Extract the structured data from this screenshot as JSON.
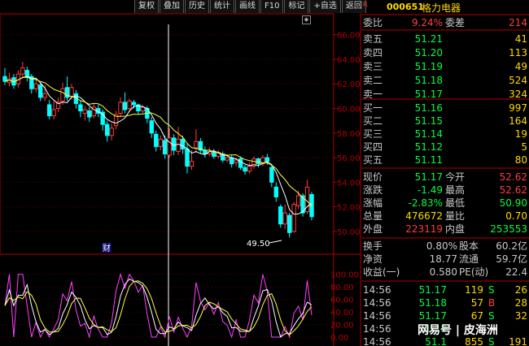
{
  "toolbar": [
    {
      "label": "复权"
    },
    {
      "label": "叠加"
    },
    {
      "label": "历史"
    },
    {
      "label": "统计"
    },
    {
      "label": "画线"
    },
    {
      "label": "F10"
    },
    {
      "label": "标记"
    },
    {
      "label": "+自选"
    },
    {
      "label": "返回"
    }
  ],
  "stock": {
    "code": "000651",
    "name": "格力电器",
    "badge": "R"
  },
  "weibi": {
    "label1": "委比",
    "value1": "9.24%",
    "label2": "委差",
    "value2": "214"
  },
  "sell": [
    {
      "label": "卖五",
      "price": "51.21",
      "vol": "41"
    },
    {
      "label": "卖四",
      "price": "51.20",
      "vol": "113"
    },
    {
      "label": "卖三",
      "price": "51.19",
      "vol": "49"
    },
    {
      "label": "卖二",
      "price": "51.18",
      "vol": "524"
    },
    {
      "label": "卖一",
      "price": "51.17",
      "vol": "324"
    }
  ],
  "buy": [
    {
      "label": "买一",
      "price": "51.16",
      "vol": "997"
    },
    {
      "label": "买二",
      "price": "51.15",
      "vol": "164"
    },
    {
      "label": "买三",
      "price": "51.14",
      "vol": "19"
    },
    {
      "label": "买四",
      "price": "51.12",
      "vol": "5"
    },
    {
      "label": "买五",
      "price": "51.11",
      "vol": "80"
    }
  ],
  "quote": [
    {
      "l1": "现价",
      "v1": "51.17",
      "l2": "今开",
      "v2": "52.62"
    },
    {
      "l1": "涨跌",
      "v1": "-1.49",
      "l2": "最高",
      "v2": "52.62"
    },
    {
      "l1": "涨幅",
      "v1": "-2.83%",
      "l2": "最低",
      "v2": "50.90"
    },
    {
      "l1": "总量",
      "v1": "476672",
      "l2": "量比",
      "v2": "0.70"
    },
    {
      "l1": "外盘",
      "v1": "223119",
      "l2": "内盘",
      "v2": "253553"
    }
  ],
  "fund": [
    {
      "l1": "换手",
      "v1": "0.80%",
      "l2": "股本",
      "v2": "60.2亿"
    },
    {
      "l1": "净资",
      "v1": "18.77",
      "l2": "流通",
      "v2": "59.7亿"
    },
    {
      "l1": "收益(一)",
      "v1": "0.580",
      "l2": "PE(动)",
      "v2": "22.4"
    }
  ],
  "ticks": [
    {
      "time": "14:56",
      "price": "51.17",
      "vol": "119",
      "bs": "S",
      "n": "26"
    },
    {
      "time": "14:56",
      "price": "51.18",
      "vol": "57",
      "bs": "B",
      "n": "28"
    },
    {
      "time": "14:56",
      "price": "51.17",
      "vol": "67",
      "bs": "S",
      "n": "32"
    },
    {
      "time": "14:56",
      "price": "51.18",
      "vol": "",
      "bs": "",
      "n": ""
    },
    {
      "time": "14:56",
      "price": "51.1",
      "vol": "855",
      "bs": "S",
      "n": "191"
    }
  ],
  "watermark": "网易号 | 皮海洲",
  "colors": {
    "up": "#ff3c3c",
    "down": "#00ffff",
    "price_green": "#00ff40",
    "yellow": "#ffd800",
    "ma": "#ffff40",
    "axis": "#b00000"
  },
  "chart_data": {
    "type": "candlestick",
    "y_ticks": [
      "66.00",
      "64.00",
      "62.00",
      "60.00",
      "58.00",
      "56.00",
      "54.00",
      "52.00",
      "50.00"
    ],
    "ylim": [
      49.0,
      67.5
    ],
    "low_annotation": "49.50",
    "marker_label": "财",
    "candles": [
      {
        "o": 62.6,
        "c": 62.2,
        "h": 63.3,
        "l": 61.9
      },
      {
        "o": 62.1,
        "c": 62.4,
        "h": 62.9,
        "l": 61.8
      },
      {
        "o": 62.5,
        "c": 61.9,
        "h": 62.8,
        "l": 61.6
      },
      {
        "o": 62.0,
        "c": 62.8,
        "h": 63.1,
        "l": 61.7
      },
      {
        "o": 62.8,
        "c": 63.3,
        "h": 63.8,
        "l": 62.5
      },
      {
        "o": 63.1,
        "c": 62.6,
        "h": 63.4,
        "l": 62.2
      },
      {
        "o": 62.6,
        "c": 61.6,
        "h": 62.8,
        "l": 61.2
      },
      {
        "o": 61.6,
        "c": 62.0,
        "h": 62.5,
        "l": 61.3
      },
      {
        "o": 61.9,
        "c": 60.9,
        "h": 62.1,
        "l": 60.6
      },
      {
        "o": 60.9,
        "c": 61.2,
        "h": 61.9,
        "l": 60.6
      },
      {
        "o": 60.3,
        "c": 59.4,
        "h": 60.7,
        "l": 59.1
      },
      {
        "o": 59.4,
        "c": 59.9,
        "h": 60.6,
        "l": 59.1
      },
      {
        "o": 60.0,
        "c": 60.5,
        "h": 60.9,
        "l": 59.7
      },
      {
        "o": 60.6,
        "c": 61.6,
        "h": 62.1,
        "l": 60.3
      },
      {
        "o": 61.7,
        "c": 60.9,
        "h": 62.6,
        "l": 60.6
      },
      {
        "o": 61.0,
        "c": 61.7,
        "h": 62.0,
        "l": 60.7
      },
      {
        "o": 61.2,
        "c": 60.4,
        "h": 61.5,
        "l": 60.0
      },
      {
        "o": 60.3,
        "c": 59.8,
        "h": 60.6,
        "l": 59.3
      },
      {
        "o": 59.6,
        "c": 59.9,
        "h": 60.2,
        "l": 59.0
      },
      {
        "o": 59.8,
        "c": 59.3,
        "h": 60.1,
        "l": 58.9
      },
      {
        "o": 59.4,
        "c": 60.1,
        "h": 60.4,
        "l": 59.2
      },
      {
        "o": 60.0,
        "c": 59.6,
        "h": 60.3,
        "l": 59.3
      },
      {
        "o": 59.7,
        "c": 58.7,
        "h": 59.9,
        "l": 58.2
      },
      {
        "o": 58.7,
        "c": 57.8,
        "h": 59.0,
        "l": 57.3
      },
      {
        "o": 57.8,
        "c": 58.4,
        "h": 58.8,
        "l": 57.4
      },
      {
        "o": 58.6,
        "c": 59.5,
        "h": 59.8,
        "l": 58.3
      },
      {
        "o": 59.6,
        "c": 60.5,
        "h": 60.9,
        "l": 59.3
      },
      {
        "o": 60.5,
        "c": 59.9,
        "h": 61.3,
        "l": 59.6
      },
      {
        "o": 60.0,
        "c": 60.6,
        "h": 60.8,
        "l": 59.7
      },
      {
        "o": 60.5,
        "c": 60.3,
        "h": 60.7,
        "l": 60.0
      },
      {
        "o": 60.3,
        "c": 59.8,
        "h": 60.4,
        "l": 59.5
      },
      {
        "o": 59.8,
        "c": 60.1,
        "h": 60.3,
        "l": 59.6
      },
      {
        "o": 60.0,
        "c": 59.2,
        "h": 60.2,
        "l": 58.8
      },
      {
        "o": 59.0,
        "c": 58.0,
        "h": 59.3,
        "l": 57.6
      },
      {
        "o": 57.9,
        "c": 56.9,
        "h": 58.2,
        "l": 56.5
      },
      {
        "o": 56.9,
        "c": 57.5,
        "h": 57.8,
        "l": 56.6
      },
      {
        "o": 57.4,
        "c": 56.3,
        "h": 57.8,
        "l": 55.9
      },
      {
        "o": 56.2,
        "c": 57.6,
        "h": 58.4,
        "l": 56.0
      },
      {
        "o": 57.6,
        "c": 56.6,
        "h": 57.9,
        "l": 56.2
      },
      {
        "o": 56.5,
        "c": 57.5,
        "h": 58.5,
        "l": 56.2
      },
      {
        "o": 57.5,
        "c": 56.7,
        "h": 57.8,
        "l": 56.3
      },
      {
        "o": 56.7,
        "c": 55.3,
        "h": 57.1,
        "l": 54.7
      },
      {
        "o": 55.3,
        "c": 55.7,
        "h": 56.6,
        "l": 55.0
      },
      {
        "o": 56.8,
        "c": 57.3,
        "h": 58.3,
        "l": 56.4
      },
      {
        "o": 57.3,
        "c": 56.6,
        "h": 57.6,
        "l": 56.3
      },
      {
        "o": 56.6,
        "c": 56.3,
        "h": 56.9,
        "l": 56.0
      },
      {
        "o": 56.3,
        "c": 56.5,
        "h": 56.8,
        "l": 56.1
      },
      {
        "o": 56.5,
        "c": 56.1,
        "h": 56.7,
        "l": 55.9
      },
      {
        "o": 56.1,
        "c": 56.4,
        "h": 56.6,
        "l": 55.9
      },
      {
        "o": 56.3,
        "c": 55.8,
        "h": 56.5,
        "l": 55.6
      },
      {
        "o": 55.8,
        "c": 56.0,
        "h": 56.2,
        "l": 55.6
      },
      {
        "o": 56.0,
        "c": 55.5,
        "h": 56.2,
        "l": 55.2
      },
      {
        "o": 55.6,
        "c": 55.8,
        "h": 56.0,
        "l": 55.3
      },
      {
        "o": 55.9,
        "c": 55.2,
        "h": 56.1,
        "l": 55.0
      },
      {
        "o": 55.2,
        "c": 54.9,
        "h": 55.4,
        "l": 54.6
      },
      {
        "o": 54.9,
        "c": 55.3,
        "h": 55.6,
        "l": 54.7
      },
      {
        "o": 55.3,
        "c": 55.9,
        "h": 56.1,
        "l": 55.1
      },
      {
        "o": 55.9,
        "c": 55.5,
        "h": 56.0,
        "l": 55.2
      },
      {
        "o": 55.5,
        "c": 56.0,
        "h": 56.2,
        "l": 55.3
      },
      {
        "o": 56.0,
        "c": 55.7,
        "h": 56.3,
        "l": 55.4
      },
      {
        "o": 55.2,
        "c": 54.0,
        "h": 55.5,
        "l": 53.6
      },
      {
        "o": 53.6,
        "c": 52.8,
        "h": 54.0,
        "l": 52.4
      },
      {
        "o": 52.0,
        "c": 50.6,
        "h": 52.2,
        "l": 50.3
      },
      {
        "o": 50.6,
        "c": 51.5,
        "h": 52.2,
        "l": 50.2
      },
      {
        "o": 51.3,
        "c": 49.9,
        "h": 51.5,
        "l": 49.5
      },
      {
        "o": 50.0,
        "c": 52.2,
        "h": 52.4,
        "l": 49.9
      },
      {
        "o": 52.1,
        "c": 52.9,
        "h": 53.3,
        "l": 51.8
      },
      {
        "o": 52.9,
        "c": 51.5,
        "h": 53.1,
        "l": 51.2
      },
      {
        "o": 51.6,
        "c": 53.6,
        "h": 54.2,
        "l": 51.4
      },
      {
        "o": 53.0,
        "c": 51.2,
        "h": 53.2,
        "l": 50.9
      }
    ],
    "indicator": {
      "y_ticks": [
        "100.00",
        "80.00",
        "60.00",
        "40.00",
        "20.00",
        "0.00"
      ],
      "ylim": [
        0,
        110
      ]
    }
  }
}
